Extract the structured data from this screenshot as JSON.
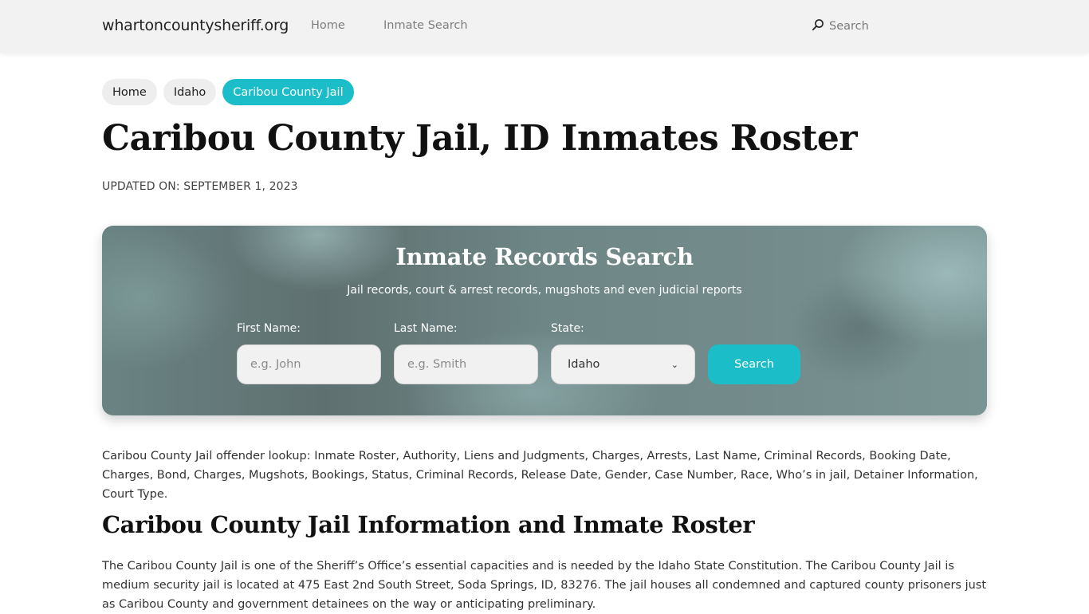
{
  "header": {
    "brand": "whartoncountysheriff.org",
    "nav": [
      {
        "label": "Home"
      },
      {
        "label": "Inmate Search"
      }
    ],
    "search_label": "Search",
    "search_icon": "search-icon"
  },
  "breadcrumb": [
    {
      "label": "Home",
      "active": false
    },
    {
      "label": "Idaho",
      "active": false
    },
    {
      "label": "Caribou County Jail",
      "active": true
    }
  ],
  "page": {
    "title": "Caribou County Jail, ID Inmates Roster",
    "updated": "UPDATED ON: SEPTEMBER 1, 2023"
  },
  "search_panel": {
    "title": "Inmate Records Search",
    "subtitle": "Jail records, court & arrest records, mugshots and even judicial reports",
    "first_name": {
      "label": "First Name:",
      "placeholder": "e.g. John",
      "value": ""
    },
    "last_name": {
      "label": "Last Name:",
      "placeholder": "e.g. Smith",
      "value": ""
    },
    "state": {
      "label": "State:",
      "selected": "Idaho"
    },
    "button_label": "Search"
  },
  "content": {
    "intro": "Caribou County Jail offender lookup: Inmate Roster, Authority, Liens and Judgments, Charges, Arrests, Last Name, Criminal Records, Booking Date, Charges, Bond, Charges, Mugshots, Bookings, Status, Criminal Records, Release Date, Gender, Case Number, Race, Who’s in jail, Detainer Information, Court Type.",
    "section_title": "Caribou County Jail Information and Inmate Roster",
    "section_body": "The Caribou County Jail is one of the Sheriff’s Office’s essential capacities and is needed by the Idaho State Constitution. The Caribou County Jail is medium security jail is located at 475 East 2nd South Street, Soda Springs, ID, 83276. The jail houses all condemned and captured county prisoners just as Caribou County and government detainees on the way or anticipating preliminary."
  },
  "colors": {
    "accent": "#1bbdc8",
    "header_bg": "#f2f2f2",
    "crumb_bg": "#eeeeee"
  }
}
